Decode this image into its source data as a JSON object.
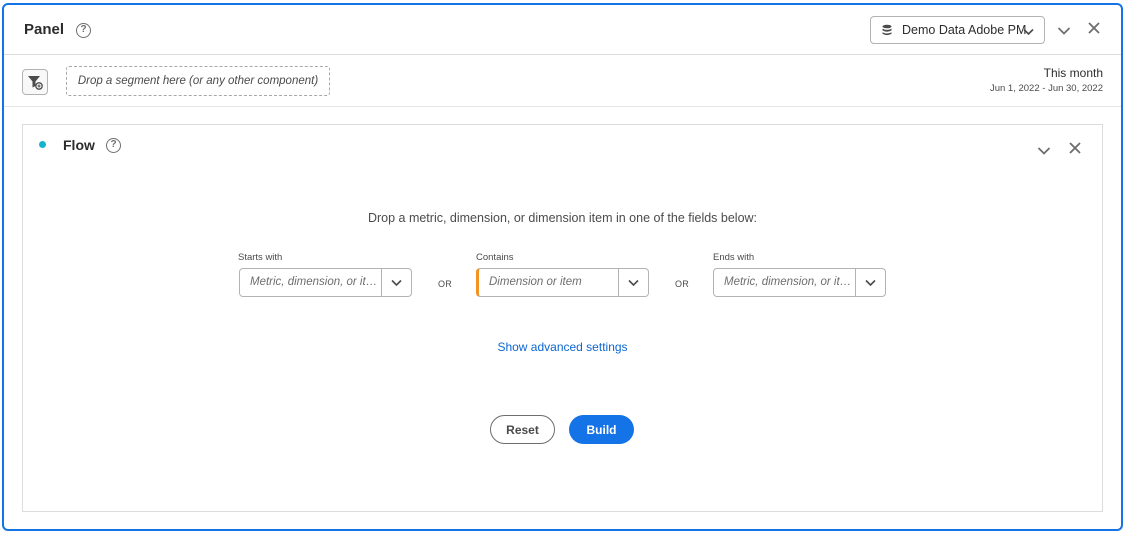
{
  "panel": {
    "title": "Panel",
    "help_glyph": "?",
    "datasource_label": "Demo Data Adobe PM",
    "icons": {
      "datasource": "database-icon",
      "collapse": "chevron-down-icon",
      "close": "close-icon"
    }
  },
  "segment_bar": {
    "drop_zone_text": "Drop a segment here (or any other component)",
    "date_label": "This month",
    "date_range": "Jun 1, 2022 - Jun 30, 2022",
    "icons": {
      "filter": "segment-filter-icon"
    }
  },
  "flow": {
    "title": "Flow",
    "help_glyph": "?",
    "status_color": "#12b5cb",
    "instruction": "Drop a metric, dimension, or dimension item in one of the fields below:",
    "fields": [
      {
        "label": "Starts with",
        "placeholder": "Metric, dimension, or item..."
      },
      {
        "label": "Contains",
        "placeholder": "Dimension or item"
      },
      {
        "label": "Ends with",
        "placeholder": "Metric, dimension, or item..."
      }
    ],
    "separator": "OR",
    "advanced_link": "Show advanced settings",
    "reset_label": "Reset",
    "build_label": "Build"
  },
  "colors": {
    "accent": "#1473e6",
    "link": "#0d66d0",
    "active_field_marker": "#f29423"
  }
}
